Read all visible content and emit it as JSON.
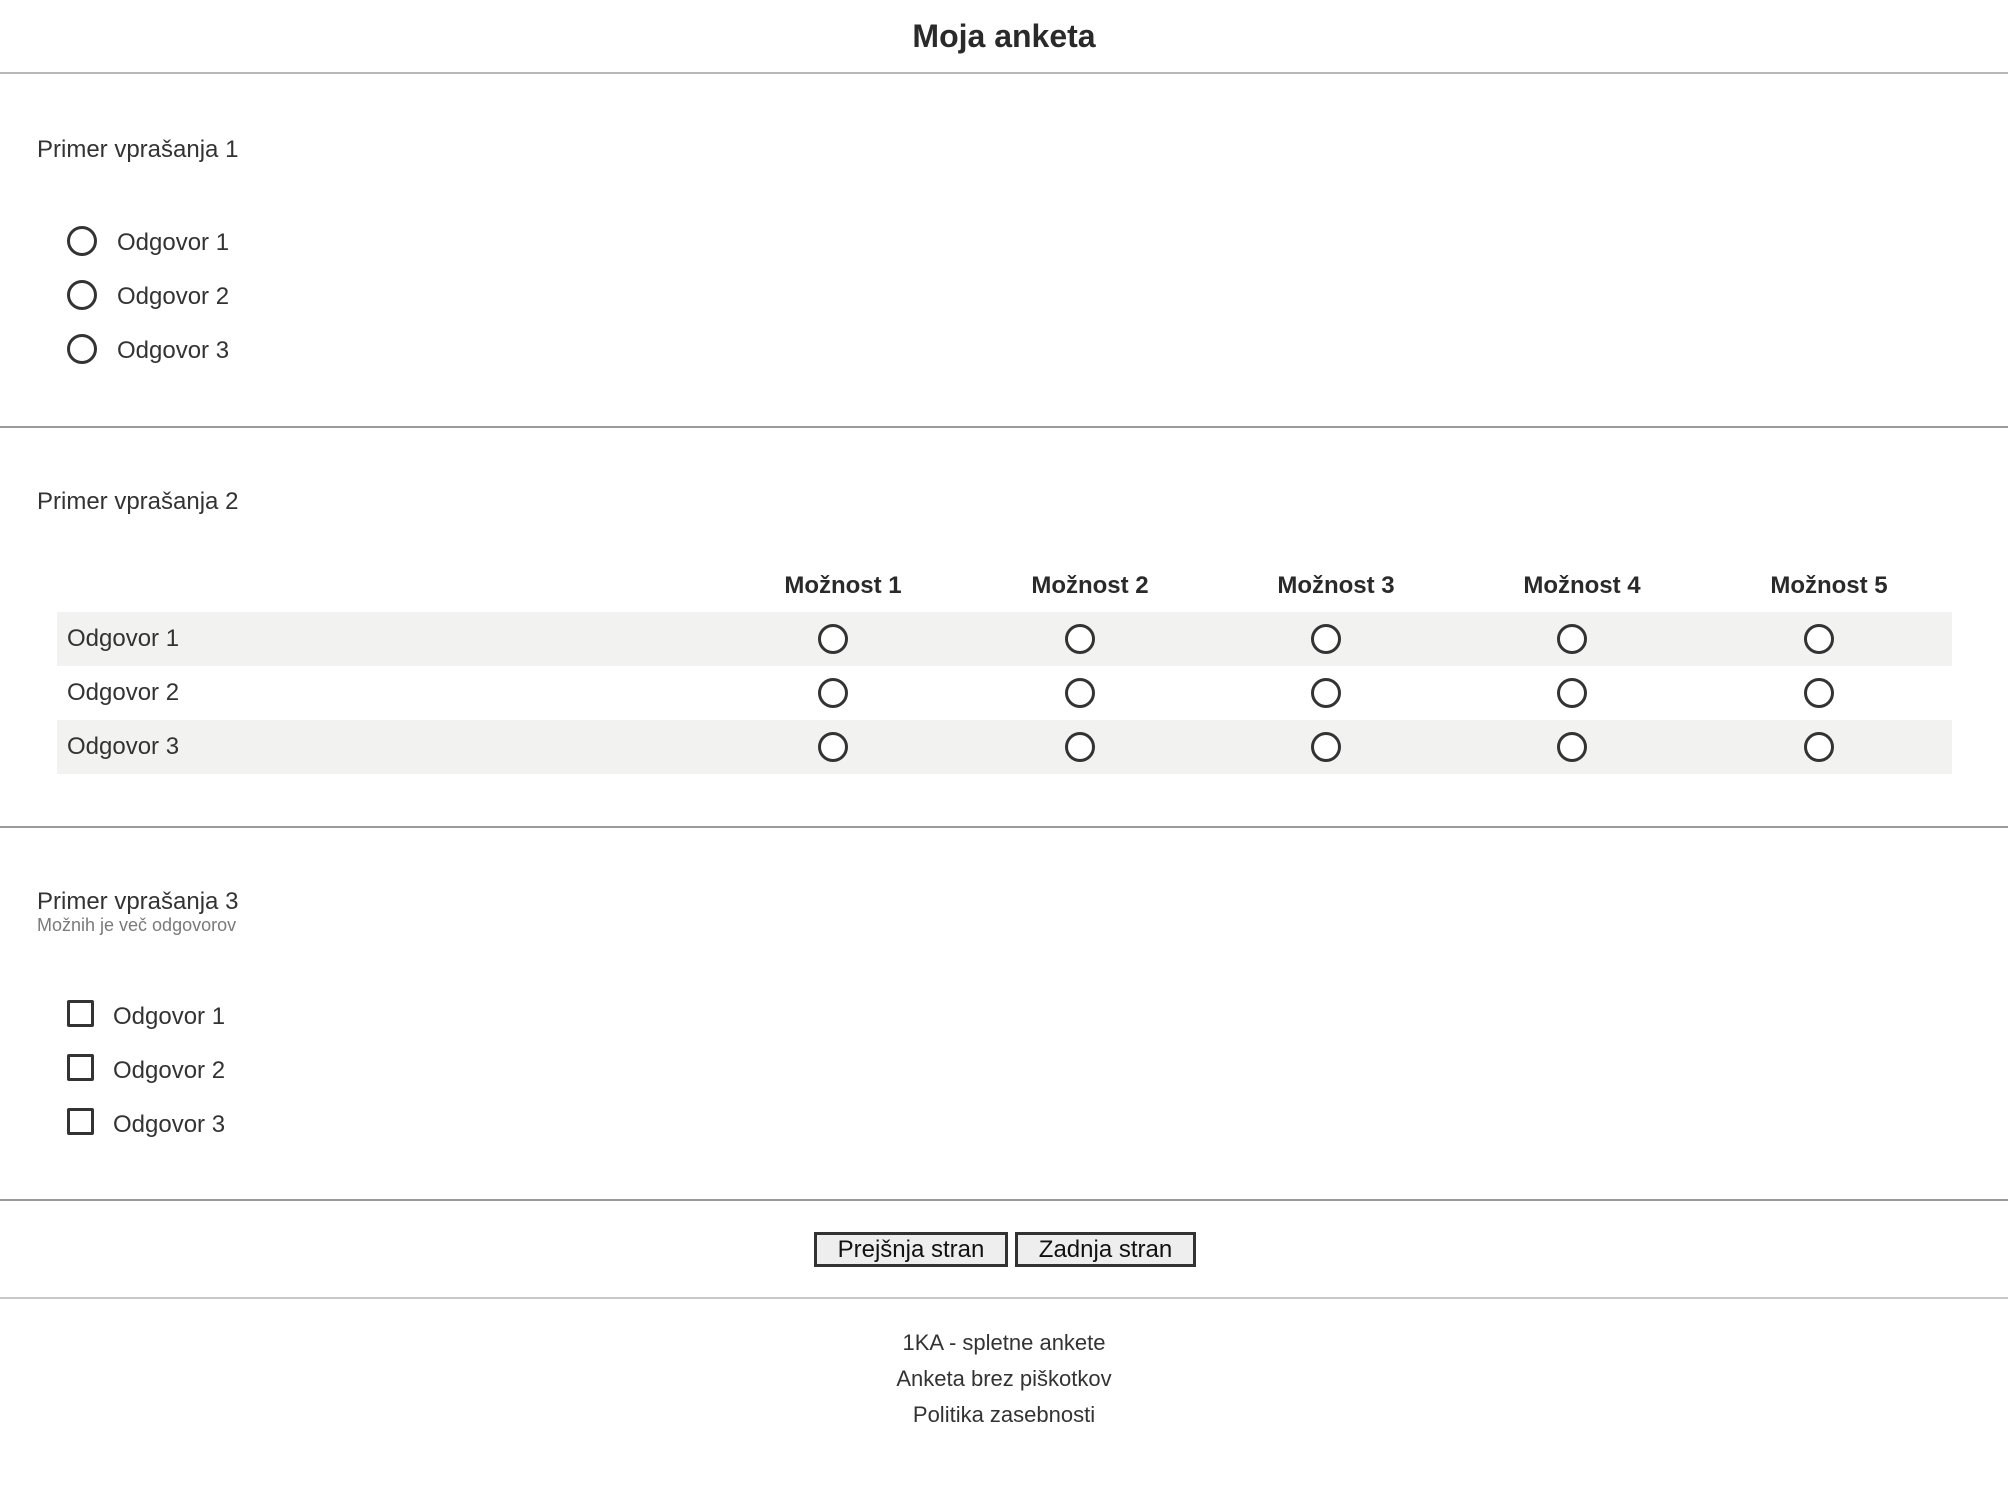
{
  "survey": {
    "title": "Moja anketa"
  },
  "q1": {
    "text": "Primer vprašanja 1",
    "options": [
      "Odgovor 1",
      "Odgovor 2",
      "Odgovor 3"
    ]
  },
  "q2": {
    "text": "Primer vprašanja 2",
    "columns": [
      "Možnost 1",
      "Možnost 2",
      "Možnost 3",
      "Možnost 4",
      "Možnost 5"
    ],
    "rows": [
      "Odgovor 1",
      "Odgovor 2",
      "Odgovor 3"
    ]
  },
  "q3": {
    "text": "Primer vprašanja 3",
    "note": "Možnih je več odgovorov",
    "options": [
      "Odgovor 1",
      "Odgovor 2",
      "Odgovor 3"
    ]
  },
  "nav": {
    "prev_label": "Prejšnja stran",
    "last_label": "Zadnja stran"
  },
  "footer": {
    "links": [
      "1KA - spletne ankete",
      "Anketa brez piškotkov",
      "Politika zasebnosti"
    ]
  }
}
